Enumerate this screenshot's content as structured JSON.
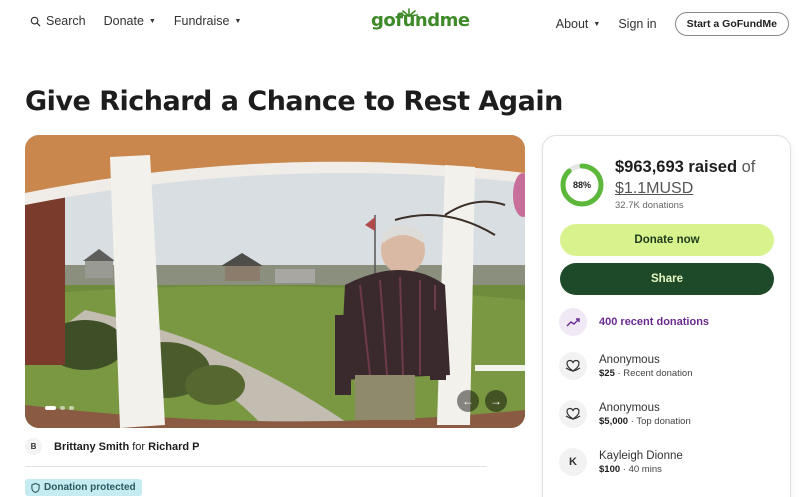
{
  "nav": {
    "search_label": "Search",
    "donate_label": "Donate",
    "fundraise_label": "Fundraise",
    "logo_text": "gofundme",
    "about_label": "About",
    "signin_label": "Sign in",
    "start_label": "Start a GoFundMe"
  },
  "campaign": {
    "title": "Give Richard a Chance to Rest Again",
    "slide_count": 3,
    "active_slide": 1
  },
  "organizer": {
    "initial": "B",
    "name": "Brittany Smith",
    "for_word": "for",
    "beneficiary": "Richard P"
  },
  "protected_label": "Donation protected",
  "progress": {
    "percent_label": "88%",
    "fraction": 0.88,
    "raised_amount": "$963,693 raised",
    "of_word": "of",
    "goal": "$1.1MUSD",
    "donation_count": "32.7K donations"
  },
  "buttons": {
    "donate_now": "Donate now",
    "share": "Share"
  },
  "recent_donations_label": "400 recent donations",
  "donations": [
    {
      "name": "Anonymous",
      "amount": "$25",
      "note": " · Recent donation",
      "avatar": "heart"
    },
    {
      "name": "Anonymous",
      "amount": "$5,000",
      "note": " · Top donation",
      "avatar": "heart"
    },
    {
      "name": "Kayleigh Dionne",
      "amount": "$100",
      "note": " · 40 mins",
      "avatar": "K"
    }
  ],
  "colors": {
    "brand_green": "#3e8a28",
    "donate_button": "#d8f38d",
    "share_button": "#1f4a2a",
    "progress_ring": "#5cb83a",
    "recent_purple": "#6a2b91",
    "protected_badge": "#c5ecf0"
  },
  "icons": {
    "search": "search-icon",
    "trending": "trending-up-icon",
    "heart": "heart-hands-icon",
    "shield": "shield-icon"
  }
}
